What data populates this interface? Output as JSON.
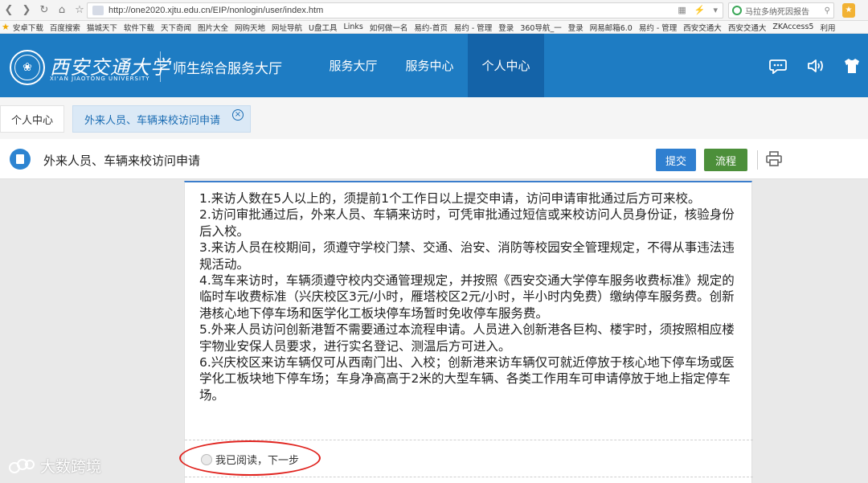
{
  "browser": {
    "url": "http://one2020.xjtu.edu.cn/EIP/nonlogin/user/index.htm",
    "search_text": "马拉多纳死因报告",
    "bookmarks": [
      "安卓下载",
      "百度搜索",
      "猫城天下",
      "软件下载",
      "天下奇闻",
      "图片大全",
      "网购天地",
      "网址导航",
      "U盘工具",
      "Links",
      "如何做一名",
      "易约-首页",
      "易约 - 管理",
      "登录",
      "360导航_一",
      "登录",
      "网易邮箱6.0",
      "易约 - 管理",
      "西安交通大",
      "西安交通大",
      "ZKAccess5",
      "利用"
    ]
  },
  "header": {
    "logo_cn": "西安交通大学",
    "logo_en": "XI'AN JIAOTONG UNIVERSITY",
    "system_title": "师生综合服务大厅",
    "nav": [
      {
        "label": "服务大厅",
        "active": false
      },
      {
        "label": "服务中心",
        "active": false
      },
      {
        "label": "个人中心",
        "active": true
      }
    ],
    "icons": [
      "chat-icon",
      "speaker-icon",
      "shirt-icon"
    ]
  },
  "tabs": {
    "home": "个人中心",
    "active": "外来人员、车辆来校访问申请"
  },
  "page": {
    "title": "外来人员、车辆来校访问申请",
    "submit_label": "提交",
    "flow_label": "流程"
  },
  "notice": {
    "items": [
      "1.来访人数在5人以上的，须提前1个工作日以上提交申请，访问申请审批通过后方可来校。",
      "2.访问审批通过后，外来人员、车辆来访时，可凭审批通过短信或来校访问人员身份证，核验身份后入校。",
      "3.来访人员在校期间，须遵守学校门禁、交通、治安、消防等校园安全管理规定，不得从事违法违规活动。",
      "4.驾车来访时，车辆须遵守校内交通管理规定，并按照《西安交通大学停车服务收费标准》规定的临时车收费标准（兴庆校区3元/小时，雁塔校区2元/小时，半小时内免费）缴纳停车服务费。创新港核心地下停车场和医学化工板块停车场暂时免收停车服务费。",
      "5.外来人员访问创新港暂不需要通过本流程申请。人员进入创新港各巨构、楼宇时，须按照相应楼宇物业安保人员要求，进行实名登记、测温后方可进入。",
      "6.兴庆校区来访车辆仅可从西南门出、入校；创新港来访车辆仅可就近停放于核心地下停车场或医学化工板块地下停车场；车身净高高于2米的大型车辆、各类工作用车可申请停放于地上指定停车场。"
    ],
    "confirm_label": "我已阅读，下一步"
  },
  "watermark": "大数跨境",
  "colors": {
    "brand_blue": "#1e7cc3",
    "nav_active": "#1463a8",
    "submit_blue": "#2f7fd0",
    "flow_green": "#4c8f3a",
    "annotation_red": "#e0221d"
  }
}
